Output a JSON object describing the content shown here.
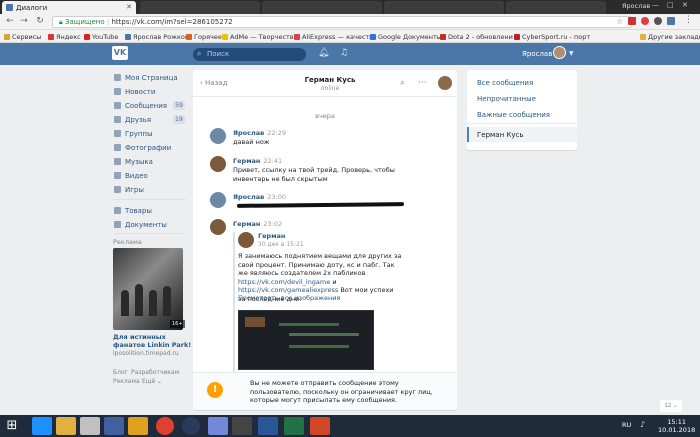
{
  "browser": {
    "tab_title": "Диалоги",
    "secure_label": "Защищено",
    "url": "https://vk.com/im?sel=286105272",
    "user": "Ярослав",
    "bookmarks": [
      {
        "label": "Сервисы",
        "color": "#e0a030"
      },
      {
        "label": "Яндекс",
        "color": "#e03030"
      },
      {
        "label": "YouTube",
        "color": "#e02020"
      },
      {
        "label": "Ярослав Рожков",
        "color": "#4a76a8"
      },
      {
        "label": "Горячее",
        "color": "#e06020"
      },
      {
        "label": "AdMe — Творчеств",
        "color": "#f0c000"
      },
      {
        "label": "AliExpress — качеств",
        "color": "#e04040"
      },
      {
        "label": "Google Документы",
        "color": "#3070e0"
      },
      {
        "label": "Dota 2 - обновлени",
        "color": "#c03020"
      },
      {
        "label": "CyberSport.ru - порт",
        "color": "#c02020"
      },
      {
        "label": "Другие закладки",
        "color": "#e0b040"
      }
    ]
  },
  "vk": {
    "logo": "VK",
    "search_placeholder": "Поиск",
    "user_name": "Ярослав",
    "sidebar": [
      {
        "label": "Моя Страница",
        "icon": "home-icon",
        "count": ""
      },
      {
        "label": "Новости",
        "icon": "news-icon",
        "count": ""
      },
      {
        "label": "Сообщения",
        "icon": "messages-icon",
        "count": "59"
      },
      {
        "label": "Друзья",
        "icon": "friends-icon",
        "count": "19"
      },
      {
        "label": "Группы",
        "icon": "groups-icon",
        "count": ""
      },
      {
        "label": "Фотографии",
        "icon": "photos-icon",
        "count": ""
      },
      {
        "label": "Музыка",
        "icon": "music-icon",
        "count": ""
      },
      {
        "label": "Видео",
        "icon": "video-icon",
        "count": ""
      },
      {
        "label": "Игры",
        "icon": "games-icon",
        "count": ""
      },
      {
        "label": "Товары",
        "icon": "goods-icon",
        "count": ""
      },
      {
        "label": "Документы",
        "icon": "docs-icon",
        "count": ""
      }
    ],
    "ads": {
      "label": "Реклама",
      "badge": "16+",
      "title": "Для истинных фанатов Linkin Park!",
      "domain": "lposolition.timepad.ru"
    },
    "footer": {
      "blog": "Блог",
      "developers": "Разработчикам",
      "ads": "Реклама",
      "more": "Ещё"
    },
    "chat": {
      "back": "Назад",
      "peer_name": "Герман Кусь",
      "peer_status": "online",
      "date": "вчера",
      "messages": [
        {
          "author": "Ярослав",
          "time": "22:29",
          "text": "давай нож"
        },
        {
          "author": "Герман",
          "time": "22:41",
          "text": "Привет, ссылку на твой трейд. Проверь, чтобы инвентарь не был скрытым"
        },
        {
          "author": "Ярослав",
          "time": "23:00",
          "text": ""
        },
        {
          "author": "Герман",
          "time": "23:02",
          "text": ""
        }
      ],
      "forwarded": {
        "author": "Герман",
        "date": "30 дек в 15:21",
        "text_before": "Я занимаюсь поднятием вещами для других за свой процент. Принимаю доту, кс и пабг. Так же являюсь создателем 2х пабликов ",
        "link1": "https://vk.com/devil_ingame",
        "and": " и ",
        "link2": "https://vk.com/gamealiexpress",
        "text_after": " Вот мои успехи за последние дни:",
        "show_all": "Посмотреть все изображения"
      },
      "blocked_notice": "Вы не можете отправить сообщение этому пользователю, поскольку он ограничивает круг лиц, которые могут присылать ему сообщения."
    },
    "filters": {
      "items": [
        "Все сообщения",
        "Непрочитанные",
        "Важные сообщения"
      ],
      "selected": "Герман Кусь"
    },
    "scroll_badge": "12"
  },
  "taskbar": {
    "lang": "RU",
    "time": "15:11",
    "date": "10.01.2018",
    "apps": [
      {
        "name": "ie",
        "color": "#1e90ff"
      },
      {
        "name": "explorer",
        "color": "#e0b040"
      },
      {
        "name": "abbyy",
        "color": "#c0c0c0"
      },
      {
        "name": "media",
        "color": "#4060a0"
      },
      {
        "name": "folder",
        "color": "#e0a020"
      },
      {
        "name": "chrome",
        "color": "#e04030"
      },
      {
        "name": "steam",
        "color": "#2a3a5a"
      },
      {
        "name": "discord",
        "color": "#7289da"
      },
      {
        "name": "app",
        "color": "#333"
      },
      {
        "name": "word",
        "color": "#2b579a"
      },
      {
        "name": "excel",
        "color": "#217346"
      },
      {
        "name": "powerpoint",
        "color": "#d24726"
      }
    ]
  }
}
